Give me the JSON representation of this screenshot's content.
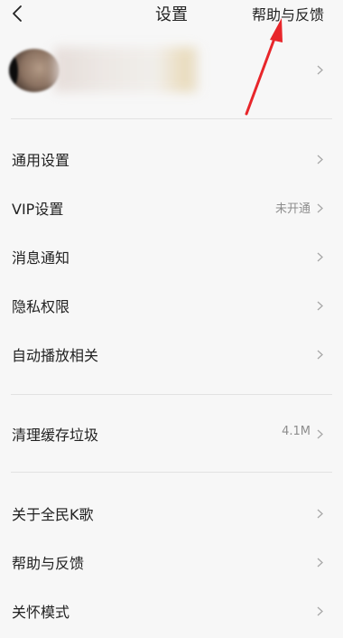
{
  "header": {
    "back_icon": "back-arrow-icon",
    "title": "设置",
    "help_link": "帮助与反馈"
  },
  "profile": {
    "avatar_icon": "avatar-image",
    "chevron_icon": "chevron-right-icon"
  },
  "groups": [
    {
      "items": [
        {
          "label": "通用设置",
          "value": ""
        },
        {
          "label": "VIP设置",
          "value": "未开通"
        },
        {
          "label": "消息通知",
          "value": ""
        },
        {
          "label": "隐私权限",
          "value": ""
        },
        {
          "label": "自动播放相关",
          "value": ""
        }
      ]
    },
    {
      "items": [
        {
          "label": "清理缓存垃圾",
          "value": "4.1M"
        }
      ]
    },
    {
      "items": [
        {
          "label": "关于全民K歌",
          "value": ""
        },
        {
          "label": "帮助与反馈",
          "value": ""
        },
        {
          "label": "关怀模式",
          "value": ""
        }
      ]
    }
  ],
  "annotation": {
    "arrow_color": "#e8262b",
    "arrow_icon": "red-pointer-arrow"
  }
}
